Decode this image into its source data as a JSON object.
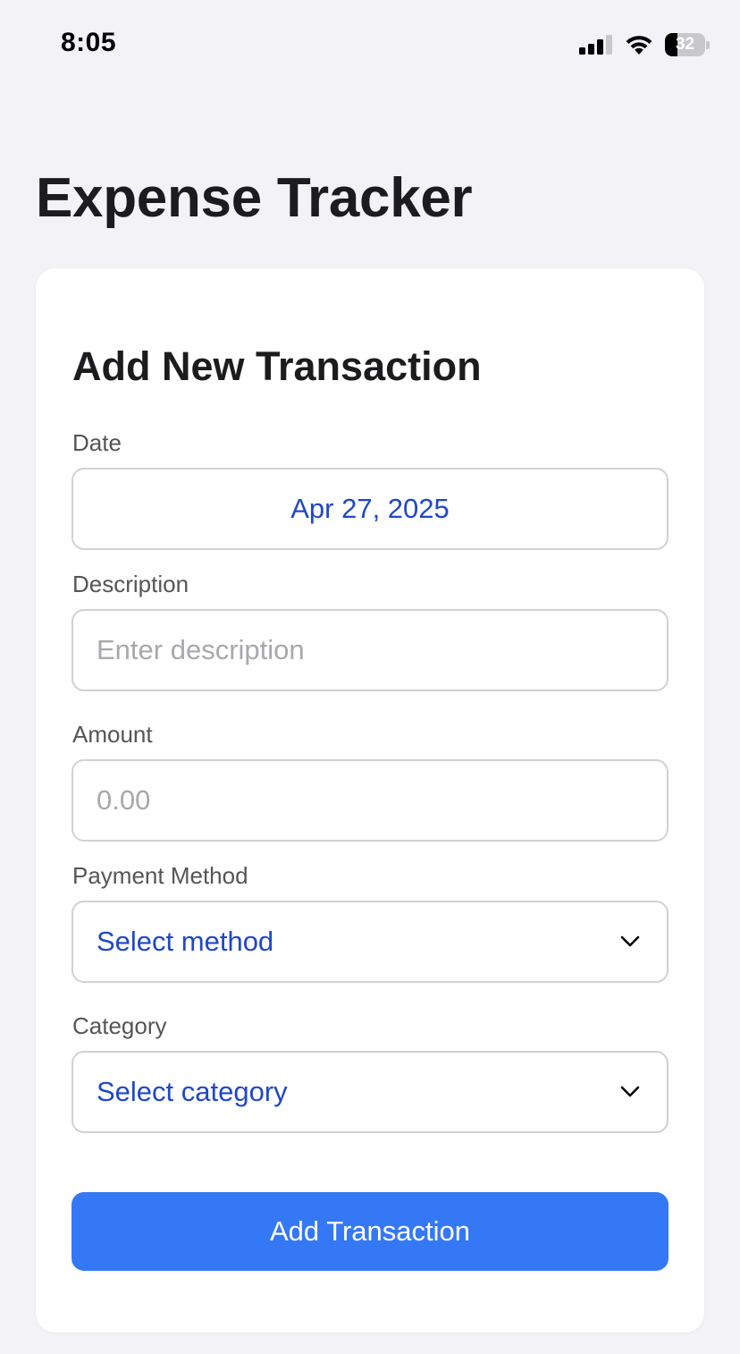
{
  "status_bar": {
    "time": "8:05",
    "battery_level": "32",
    "battery_fraction": 0.32,
    "icons": [
      "cellular-signal-icon",
      "wifi-icon",
      "battery-icon"
    ]
  },
  "app": {
    "title": "Expense Tracker"
  },
  "form": {
    "title": "Add New Transaction",
    "date": {
      "label": "Date",
      "value": "Apr 27, 2025"
    },
    "description": {
      "label": "Description",
      "value": "",
      "placeholder": "Enter description"
    },
    "amount": {
      "label": "Amount",
      "value": "",
      "placeholder": "0.00"
    },
    "payment_method": {
      "label": "Payment Method",
      "selected": "Select method"
    },
    "category": {
      "label": "Category",
      "selected": "Select category"
    },
    "submit_label": "Add Transaction"
  },
  "colors": {
    "background": "#f2f2f7",
    "card": "#ffffff",
    "accent": "#3478f6",
    "value_text": "#1f47c8",
    "placeholder_text": "#a8a8ad"
  }
}
